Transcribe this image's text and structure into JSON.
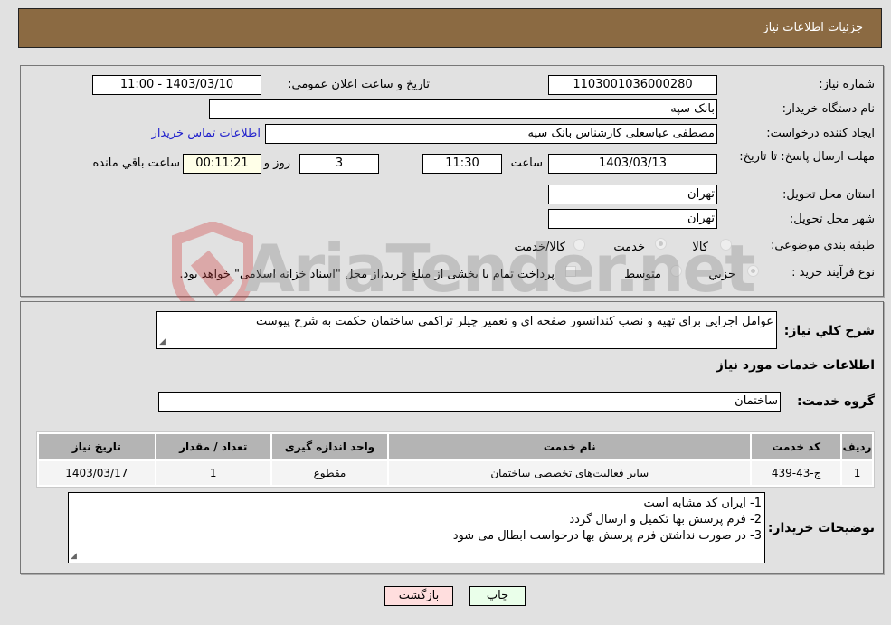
{
  "header": {
    "title": "جزئیات اطلاعات نیاز"
  },
  "details": {
    "need_number_label": "شماره نیاز:",
    "need_number": "1103001036000280",
    "announce_label": "تاریخ و ساعت اعلان عمومي:",
    "announce_value": "1403/03/10 - 11:00",
    "buyer_org_label": "نام دستگاه خریدار:",
    "buyer_org": "بانک سپه",
    "creator_label": "ایجاد کننده درخواست:",
    "creator": "مصطفی عباسعلی کارشناس بانک سپه",
    "contact_link": "اطلاعات تماس خریدار",
    "deadline_label": "مهلت ارسال پاسخ: تا تاریخ:",
    "deadline_date": "1403/03/13",
    "time_label": "ساعت",
    "deadline_time": "11:30",
    "days": "3",
    "days_label": "روز و",
    "remaining": "00:11:21",
    "remaining_label": "ساعت باقي مانده",
    "province_label": "استان محل تحویل:",
    "province": "تهران",
    "city_label": "شهر محل تحویل:",
    "city": "تهران",
    "category_label": "طبقه بندی موضوعی:",
    "category_options": [
      {
        "label": "کالا",
        "selected": false
      },
      {
        "label": "خدمت",
        "selected": true
      },
      {
        "label": "کالا/خدمت",
        "selected": false
      }
    ],
    "process_label": "نوع فرآیند خرید :",
    "process_options": [
      {
        "label": "جزیي",
        "selected": true
      },
      {
        "label": "متوسط",
        "selected": false
      }
    ],
    "treasury_checkbox_label": "پرداخت تمام یا بخشی از مبلغ خرید،از محل \"اسناد خزانه اسلامی\" خواهد بود."
  },
  "summary": {
    "label": "شرح کلي نیاز:",
    "value": "عوامل اجرایی برای تهیه و نصب کندانسور صفحه ای و تعمیر چیلر تراکمی ساختمان حکمت به شرح پیوست"
  },
  "services": {
    "section_title": "اطلاعات خدمات مورد نیاز",
    "group_label": "گروه خدمت:",
    "group_value": "ساختمان",
    "columns": [
      "ردیف",
      "کد خدمت",
      "نام خدمت",
      "واحد اندازه گیری",
      "تعداد / مقدار",
      "تاریخ نیاز"
    ],
    "rows": [
      {
        "row": "1",
        "code": "ج-43-439",
        "name": "سایر فعالیت‌های تخصصی ساختمان",
        "unit": "مقطوع",
        "qty": "1",
        "date": "1403/03/17"
      }
    ]
  },
  "buyer_notes": {
    "label": "توضیحات خریدار:",
    "lines": [
      "1- ایران کد مشابه است",
      "2- فرم پرسش بها تکمیل و ارسال گردد",
      "3- در صورت نداشتن فرم پرسش بها درخواست ابطال می شود"
    ]
  },
  "buttons": {
    "print": "چاپ",
    "back": "بازگشت"
  },
  "watermark": {
    "text": "AriaTender.net"
  },
  "colors": {
    "title_bar": "#8b6a42",
    "back_button": "#ffdede",
    "print_button": "#eaffea",
    "remaining_box": "#ffffe8",
    "link": "#2222cc"
  }
}
